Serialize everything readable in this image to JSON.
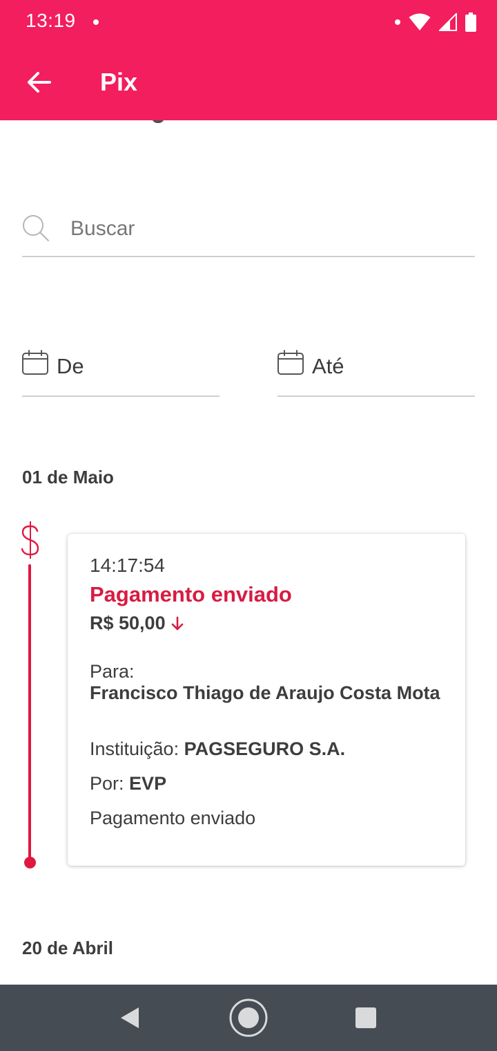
{
  "status_bar": {
    "time": "13:19",
    "icons": [
      "notification-dot-icon",
      "wifi-icon",
      "signal-icon",
      "battery-icon"
    ]
  },
  "app_bar": {
    "title": "Pix",
    "back_icon": "arrow-left-icon"
  },
  "search": {
    "placeholder": "Buscar",
    "value": ""
  },
  "filters": {
    "from_label": "De",
    "to_label": "Até"
  },
  "sections": [
    {
      "date": "01 de Maio",
      "transactions": [
        {
          "time": "14:17:54",
          "status": "Pagamento enviado",
          "amount": "R$ 50,00",
          "direction": "down",
          "to_label": "Para:",
          "to_name": "Francisco Thiago de Araujo Costa Mota",
          "institution_label": "Instituição:",
          "institution": "PAGSEGURO S.A.",
          "by_label": "Por:",
          "by": "EVP",
          "description": "Pagamento enviado"
        }
      ]
    },
    {
      "date": "20 de Abril",
      "transactions": []
    }
  ],
  "colors": {
    "brand": "#f21e5e",
    "accent_red": "#d81b42",
    "nav_bar": "#464c54"
  }
}
